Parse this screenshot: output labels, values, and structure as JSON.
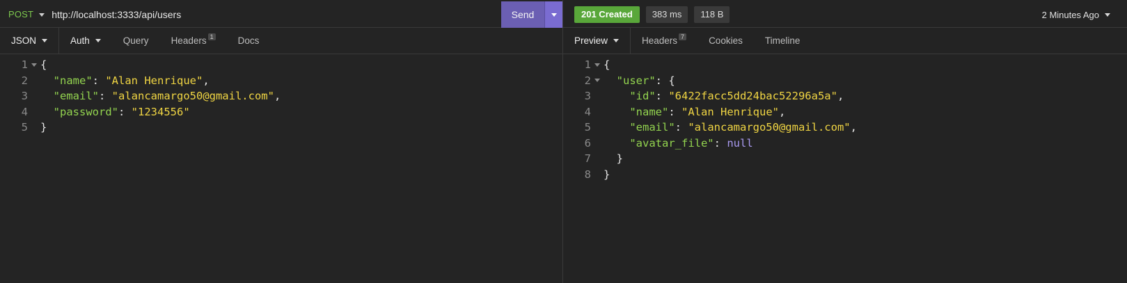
{
  "request": {
    "method": "POST",
    "url": "http://localhost:3333/api/users",
    "send_label": "Send",
    "tabs": {
      "body": "JSON",
      "auth": "Auth",
      "query": "Query",
      "headers": "Headers",
      "headers_count": "1",
      "docs": "Docs"
    },
    "editor": {
      "line_numbers": [
        "1",
        "2",
        "3",
        "4",
        "5"
      ],
      "open_brace": "{",
      "close_brace": "}",
      "name_key": "\"name\"",
      "name_val": "\"Alan Henrique\"",
      "email_key": "\"email\"",
      "email_val": "\"alancamargo50@gmail.com\"",
      "password_key": "\"password\"",
      "password_val": "\"1234556\""
    }
  },
  "response": {
    "status": "201 Created",
    "time": "383 ms",
    "size": "118 B",
    "history": "2 Minutes Ago",
    "tabs": {
      "preview": "Preview",
      "headers": "Headers",
      "headers_count": "7",
      "cookies": "Cookies",
      "timeline": "Timeline"
    },
    "editor": {
      "line_numbers": [
        "1",
        "2",
        "3",
        "4",
        "5",
        "6",
        "7",
        "8"
      ],
      "open_brace": "{",
      "close_brace": "}",
      "user_key": "\"user\"",
      "id_key": "\"id\"",
      "id_val": "\"6422facc5dd24bac52296a5a\"",
      "name_key": "\"name\"",
      "name_val": "\"Alan Henrique\"",
      "email_key": "\"email\"",
      "email_val": "\"alancamargo50@gmail.com\"",
      "avatar_key": "\"avatar_file\"",
      "avatar_val": "null"
    }
  },
  "colors": {
    "method": "#7ec94e",
    "send": "#6b5fb3",
    "status_success": "#59a73a",
    "json_key": "#93d44f",
    "json_string": "#f0d543",
    "json_null": "#a99af0"
  },
  "icons": [
    "chevron-down-icon",
    "fold-arrow-icon"
  ]
}
